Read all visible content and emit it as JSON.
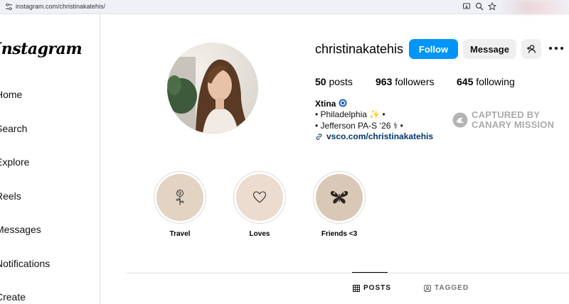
{
  "browser": {
    "url": "instagram.com/christinakatehis/"
  },
  "sidebar": {
    "logo": "Instagram",
    "items": [
      {
        "label": "Home"
      },
      {
        "label": "Search"
      },
      {
        "label": "Explore"
      },
      {
        "label": "Reels"
      },
      {
        "label": "Messages"
      },
      {
        "label": "Notifications"
      },
      {
        "label": "Create"
      }
    ]
  },
  "profile": {
    "username": "christinakatehis",
    "follow_label": "Follow",
    "message_label": "Message",
    "stats": {
      "posts_count": "50",
      "posts_label": "posts",
      "followers_count": "963",
      "followers_label": "followers",
      "following_count": "645",
      "following_label": "following"
    },
    "full_name": "Xtina",
    "bio": [
      "• Philadelphia ✨ •",
      "• Jefferson PA-S ‘26 ⚕ •"
    ],
    "link": "vsco.com/christinakatehis"
  },
  "watermark": {
    "line1": "CAPTURED BY",
    "line2": "CANARY MISSION"
  },
  "highlights": [
    {
      "label": "Travel",
      "icon": "rose-icon"
    },
    {
      "label": "Loves",
      "icon": "heart-icon"
    },
    {
      "label": "Friends <3",
      "icon": "butterfly-icon"
    }
  ],
  "tabs": [
    {
      "label": "POSTS",
      "active": true
    },
    {
      "label": "TAGGED",
      "active": false
    }
  ],
  "colors": {
    "accent": "#0095f6",
    "link": "#00376b",
    "highlight_bg_1": "#e2d3c3",
    "highlight_bg_2": "#ecdcd0",
    "highlight_bg_3": "#d9c8b5"
  }
}
